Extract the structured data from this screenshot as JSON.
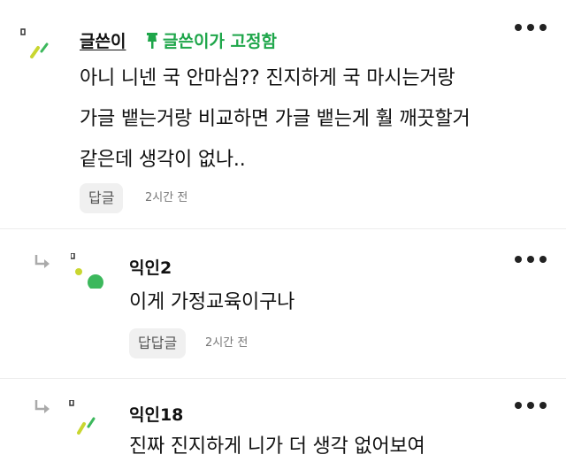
{
  "comments": [
    {
      "author": "글쓴이",
      "pin_label": "글쓴이가 고정함",
      "text": "아니 니넨 국 안마심?? 진지하게 국 마시는거랑\n가글 뱉는거랑 비교하면 가글 뱉는게 훨 깨끗할거\n같은데 생각이 없나..",
      "reply_label": "답글",
      "time": "2시간 전"
    },
    {
      "author": "익인2",
      "text": "이게 가정교육이구나",
      "reply_label": "답답글",
      "time": "2시간 전"
    },
    {
      "author": "익인18",
      "text": "진짜 진지하게 니가 더 생각 없어보여"
    }
  ],
  "colors": {
    "pin_green": "#1ea64a",
    "confetti_yellow": "#c9d630",
    "confetti_green": "#3cb85c"
  },
  "icons": [
    "push-pin-icon",
    "reply-arrow-icon",
    "more-options-icon",
    "avatar-icon"
  ]
}
